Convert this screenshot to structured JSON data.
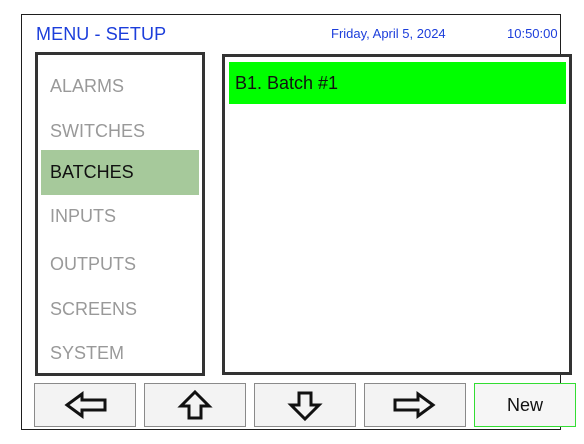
{
  "header": {
    "title": "MENU - SETUP",
    "date": "Friday, April 5, 2024",
    "time": "10:50:00"
  },
  "menu": {
    "items": [
      {
        "label": "ALARMS",
        "active": false
      },
      {
        "label": "SWITCHES",
        "active": false
      },
      {
        "label": "BATCHES",
        "active": true
      },
      {
        "label": "INPUTS",
        "active": false
      },
      {
        "label": "OUTPUTS",
        "active": false
      },
      {
        "label": "SCREENS",
        "active": false
      },
      {
        "label": "SYSTEM",
        "active": false
      }
    ]
  },
  "list": {
    "items": [
      {
        "label": "B1. Batch #1",
        "selected": true
      }
    ]
  },
  "buttons": {
    "left_icon": "arrow-left-icon",
    "up_icon": "arrow-up-icon",
    "down_icon": "arrow-down-icon",
    "right_icon": "arrow-right-icon",
    "new_label": "New"
  },
  "colors": {
    "header_text": "#1c3edb",
    "active_menu_bg": "#a6c99b",
    "selected_row_bg": "#00ff00",
    "new_button_border": "#33dd33"
  }
}
